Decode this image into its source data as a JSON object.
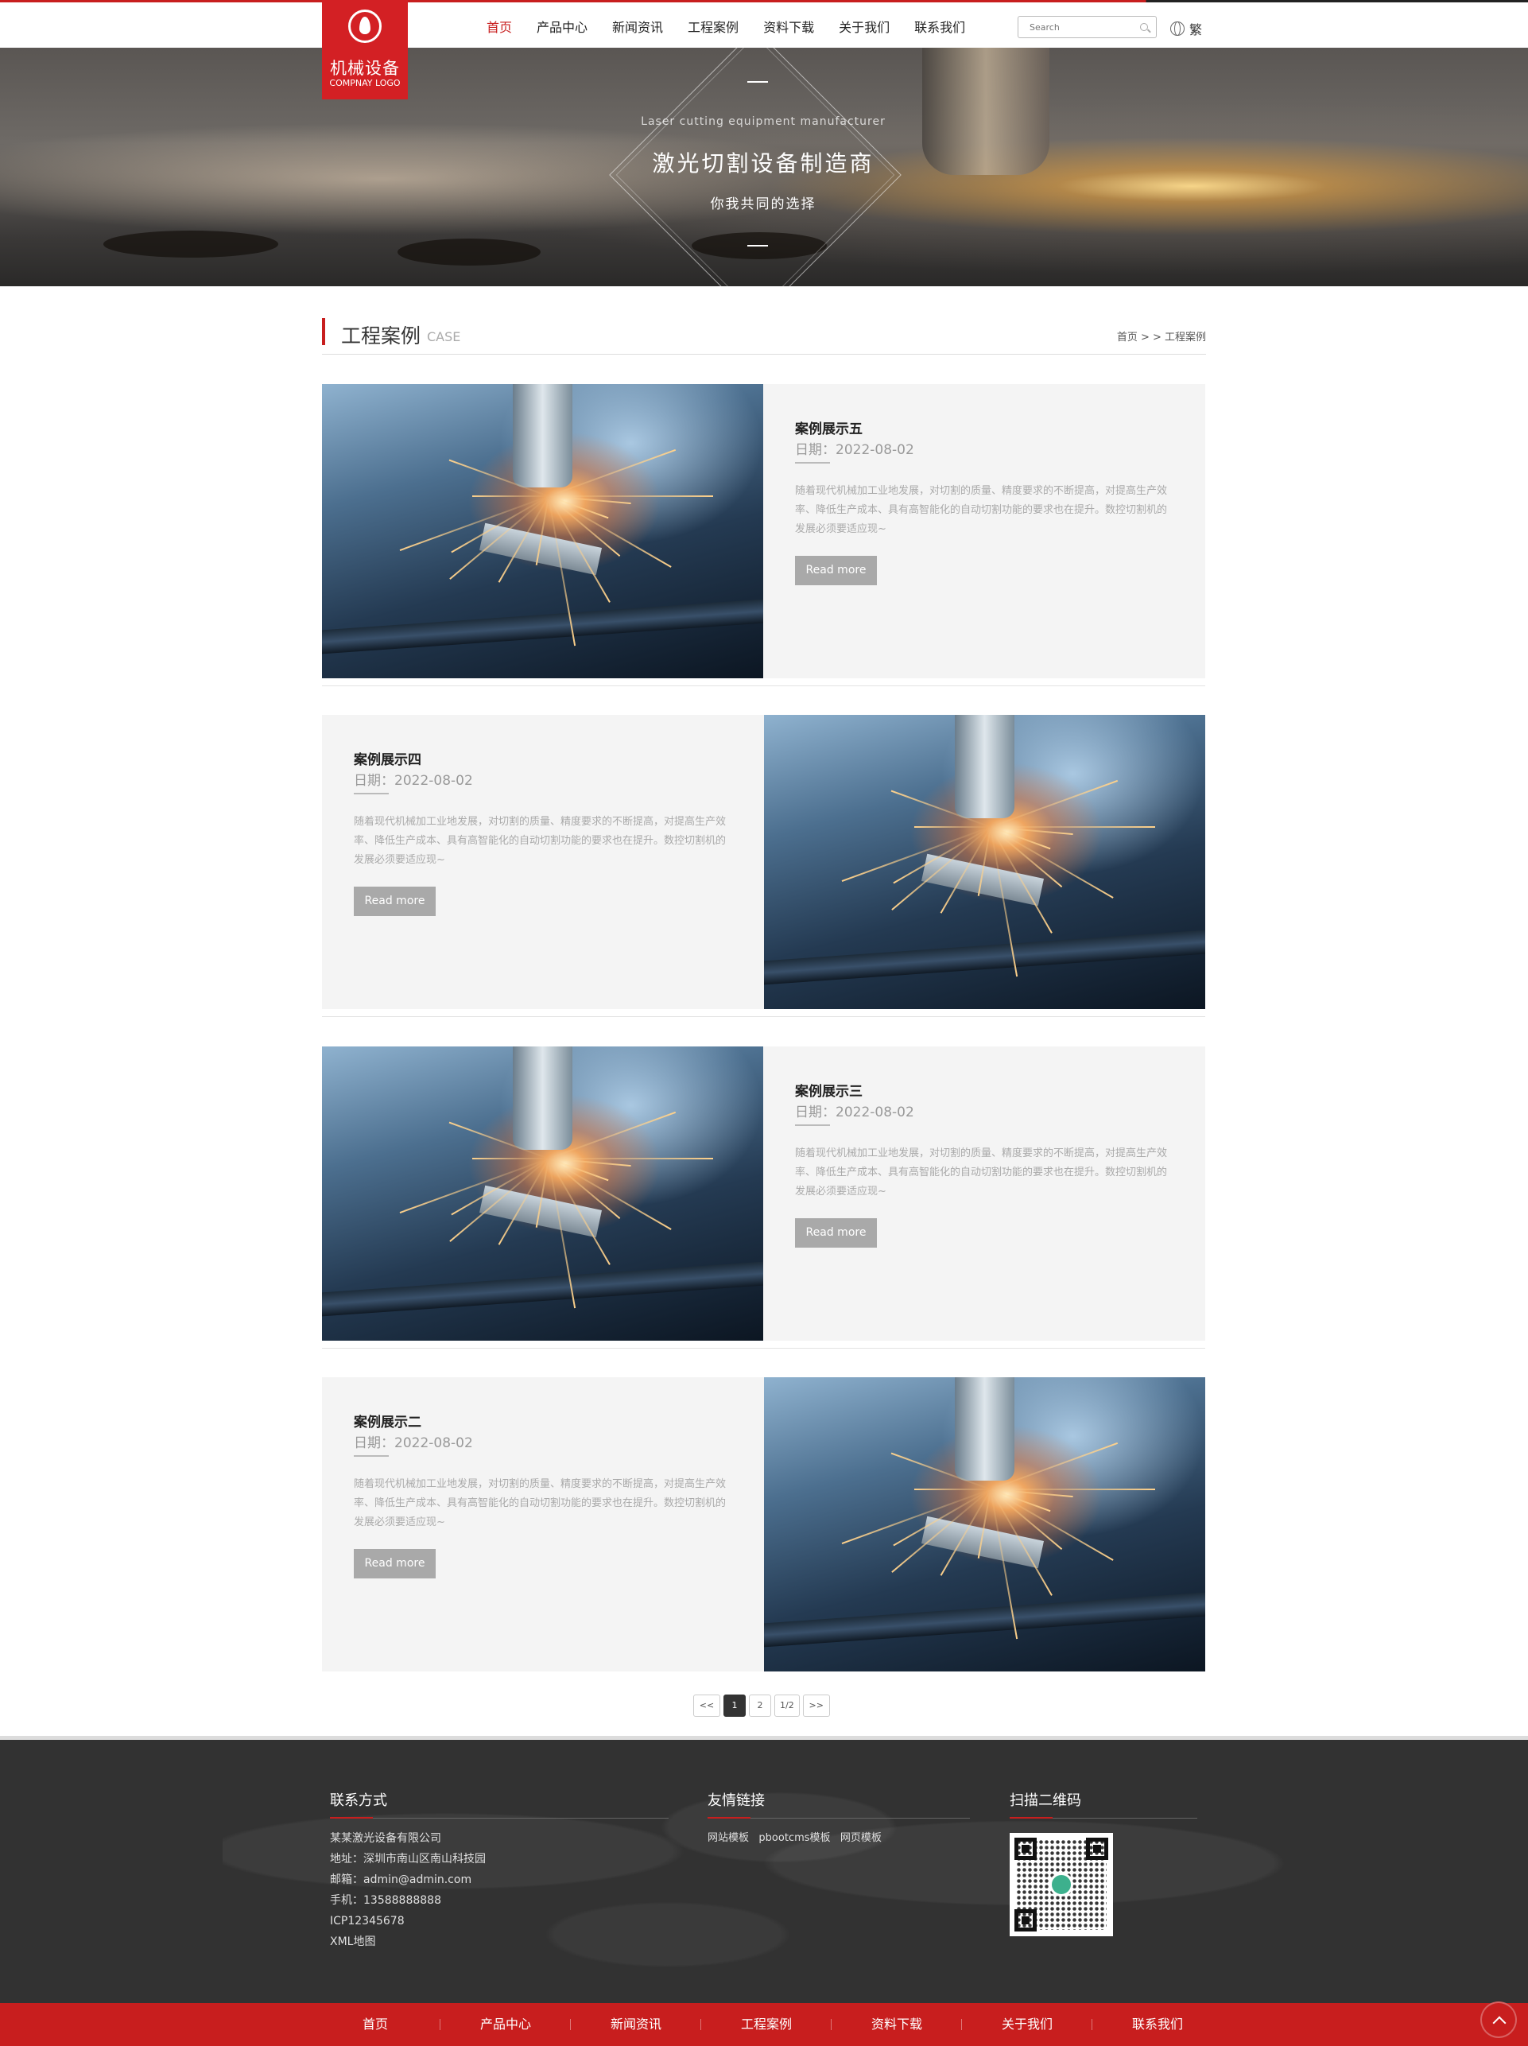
{
  "logo": {
    "name": "机械设备",
    "sub": "COMPNAY LOGO"
  },
  "nav": [
    {
      "label": "首页",
      "active": true
    },
    {
      "label": "产品中心"
    },
    {
      "label": "新闻资讯"
    },
    {
      "label": "工程案例"
    },
    {
      "label": "资料下载"
    },
    {
      "label": "关于我们"
    },
    {
      "label": "联系我们"
    }
  ],
  "search": {
    "placeholder": "Search"
  },
  "lang": {
    "label": "繁"
  },
  "banner": {
    "subtitle_en": "Laser cutting equipment manufacturer",
    "title": "激光切割设备制造商",
    "tagline": "你我共同的选择"
  },
  "section": {
    "title": "工程案例",
    "title_en": "CASE",
    "breadcrumb": "首页 > > 工程案例"
  },
  "cases": [
    {
      "title": "案例展示五",
      "date": "日期：2022-08-02",
      "desc": "随着现代机械加工业地发展，对切割的质量、精度要求的不断提高，对提高生产效率、降低生产成本、具有高智能化的自动切割功能的要求也在提升。数控切割机的发展必须要适应现~",
      "button": "Read more"
    },
    {
      "title": "案例展示四",
      "date": "日期：2022-08-02",
      "desc": "随着现代机械加工业地发展，对切割的质量、精度要求的不断提高，对提高生产效率、降低生产成本、具有高智能化的自动切割功能的要求也在提升。数控切割机的发展必须要适应现~",
      "button": "Read more"
    },
    {
      "title": "案例展示三",
      "date": "日期：2022-08-02",
      "desc": "随着现代机械加工业地发展，对切割的质量、精度要求的不断提高，对提高生产效率、降低生产成本、具有高智能化的自动切割功能的要求也在提升。数控切割机的发展必须要适应现~",
      "button": "Read more"
    },
    {
      "title": "案例展示二",
      "date": "日期：2022-08-02",
      "desc": "随着现代机械加工业地发展，对切割的质量、精度要求的不断提高，对提高生产效率、降低生产成本、具有高智能化的自动切割功能的要求也在提升。数控切割机的发展必须要适应现~",
      "button": "Read more"
    }
  ],
  "pager": {
    "prev": "<<",
    "page1": "1",
    "page2": "2",
    "total": "1/2",
    "next": ">>"
  },
  "footer": {
    "contact_title": "联系方式",
    "company": "某某激光设备有限公司",
    "address": "地址：深圳市南山区南山科技园",
    "email": "邮箱：admin@admin.com",
    "phone": "手机：13588888888",
    "icp": "ICP12345678",
    "sitemap": "XML地图",
    "links_title": "友情链接",
    "links": [
      "网站模板",
      "pbootcms模板",
      "网页模板"
    ],
    "qr_title": "扫描二维码"
  },
  "bottom_nav": [
    "首页",
    "产品中心",
    "新闻资讯",
    "工程案例",
    "资料下载",
    "关于我们",
    "联系我们"
  ],
  "colors": {
    "brand": "#c81e1e",
    "footer_bg": "#323232",
    "button_gray": "#a9a9a9"
  },
  "icons": {
    "search": "magnifier-icon",
    "lang": "globe-icon",
    "to_top": "chevron-up-icon"
  }
}
